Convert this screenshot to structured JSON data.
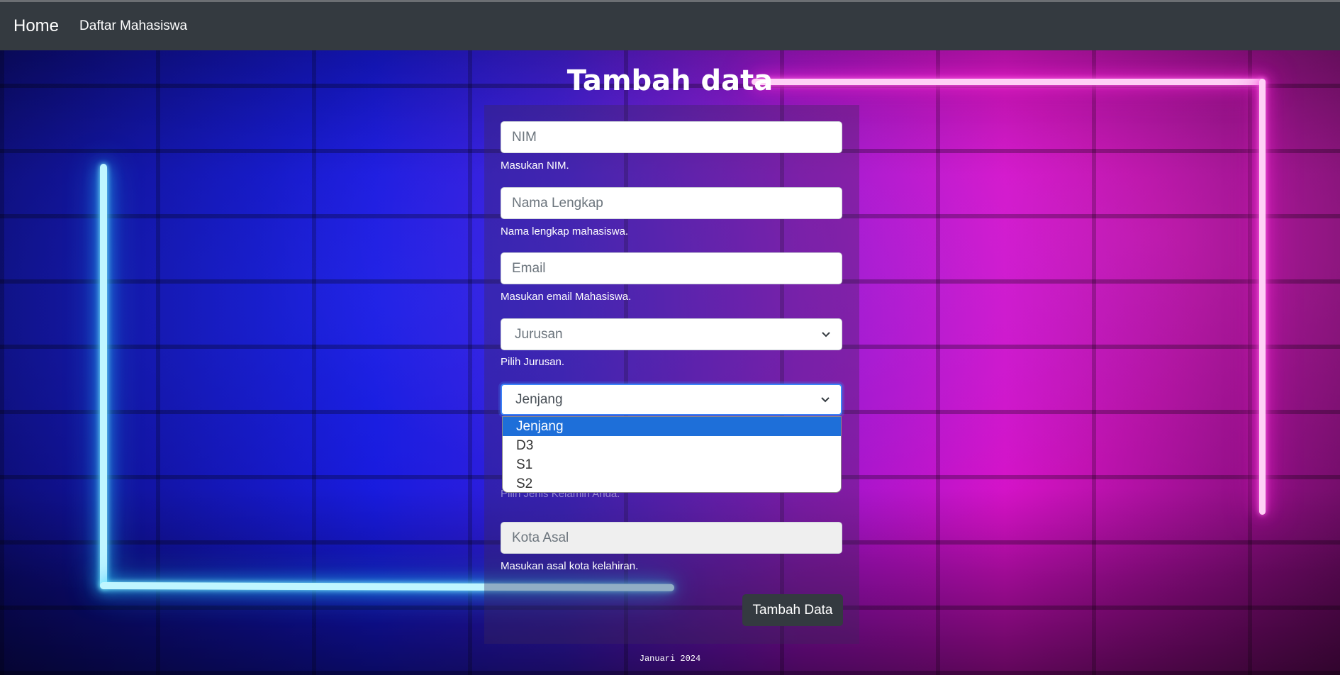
{
  "navbar": {
    "brand": "Home",
    "links": [
      "Daftar Mahasiswa"
    ]
  },
  "page": {
    "title": "Tambah data",
    "footer": "Januari 2024"
  },
  "form": {
    "nim": {
      "placeholder": "NIM",
      "help": "Masukan NIM."
    },
    "nama": {
      "placeholder": "Nama Lengkap",
      "help": "Nama lengkap mahasiswa."
    },
    "email": {
      "placeholder": "Email",
      "help": "Masukan email Mahasiswa."
    },
    "jurusan": {
      "selected": "Jurusan",
      "help": "Pilih Jurusan."
    },
    "jenjang": {
      "selected": "Jenjang",
      "options": [
        "Jenjang",
        "D3",
        "S1",
        "S2"
      ]
    },
    "jenis_kelamin": {
      "help": "Pilih Jenis Kelamin Anda."
    },
    "kota": {
      "placeholder": "Kota Asal",
      "help": "Masukan asal kota kelahiran."
    },
    "submit_label": "Tambah Data"
  },
  "icons": {
    "select_arrow": "chevron-down-icon"
  }
}
